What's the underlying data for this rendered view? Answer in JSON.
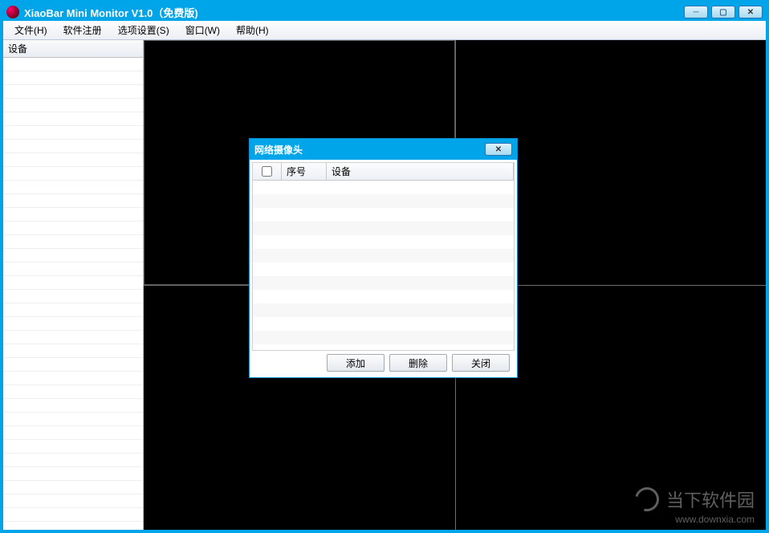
{
  "app": {
    "title": "XiaoBar Mini Monitor V1.0（免费版)"
  },
  "menu": {
    "file": "文件(H)",
    "register": "软件注册",
    "options": "选项设置(S)",
    "window": "窗口(W)",
    "help": "帮助(H)"
  },
  "sidebar": {
    "header": "设备"
  },
  "dialog": {
    "title": "网络摄像头",
    "columns": {
      "checkbox": "",
      "seq": "序号",
      "device": "设备"
    },
    "buttons": {
      "add": "添加",
      "delete": "删除",
      "close": "关闭"
    }
  },
  "watermark": {
    "text": "当下软件园",
    "url": "www.downxia.com"
  }
}
